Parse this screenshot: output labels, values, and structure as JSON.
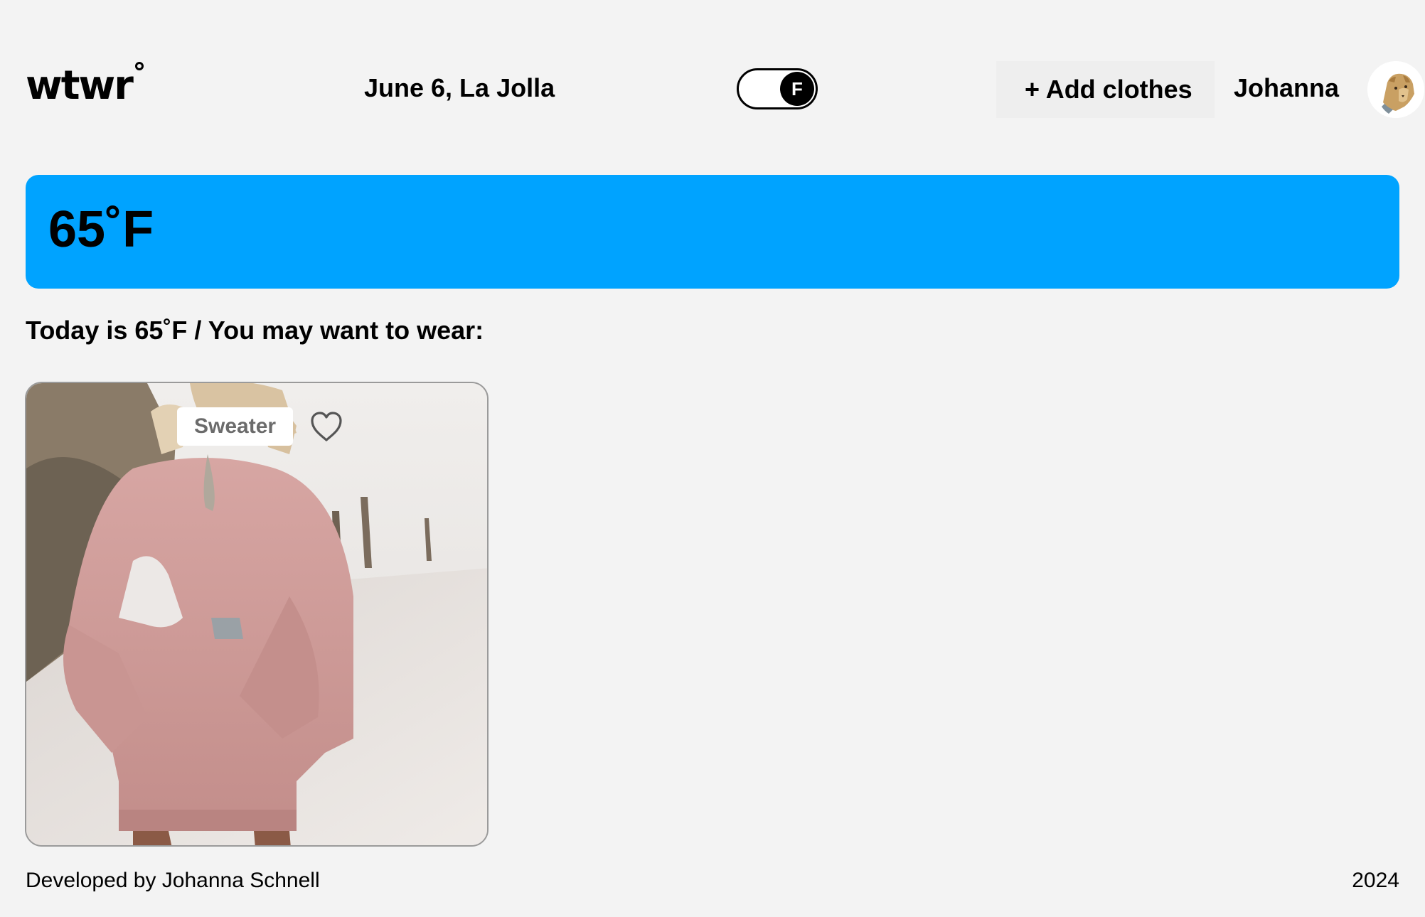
{
  "header": {
    "logo": "wtwr",
    "date_location": "June 6, La Jolla",
    "unit_toggle": {
      "selected": "F"
    },
    "add_clothes_label": "+ Add clothes",
    "username": "Johanna",
    "avatar_icon": "lion-avatar-icon"
  },
  "weather": {
    "temperature": "65˚F",
    "banner_color": "#00a3ff"
  },
  "main": {
    "suggestion": "Today is 65˚F / You may want to wear:",
    "items": [
      {
        "label": "Sweater",
        "liked": false,
        "like_icon": "heart-outline-icon"
      }
    ]
  },
  "footer": {
    "credit": "Developed by Johanna Schnell",
    "year": "2024"
  }
}
